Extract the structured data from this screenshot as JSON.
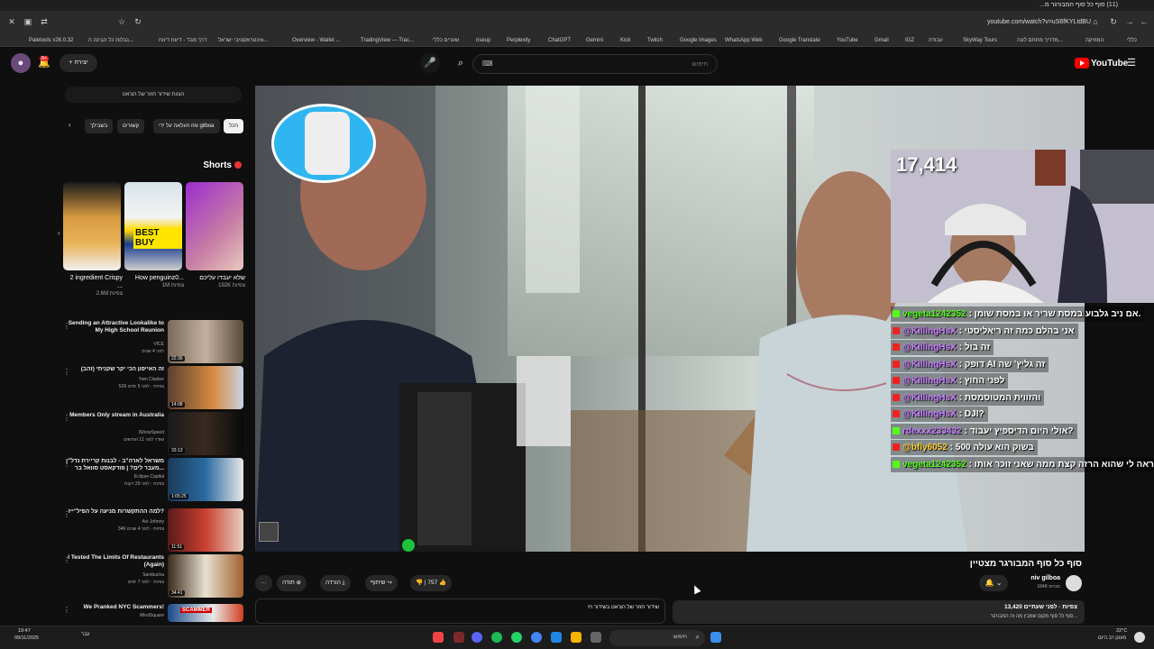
{
  "browser": {
    "tab_title": "(11) סוף כל סוף המבורגר מ...",
    "url": "youtube.com/watch?v=uS6fKYLtdBU",
    "bookmarks": [
      "Paletools v26.0.32",
      "נבלות כל הבינה ה...",
      "דרך מבד - דיווח דיווח",
      "אינטראקטיבי ישראל...",
      "Overview - Wallet ...",
      "TradingView — Trac...",
      "שערים כללי",
      "riseup",
      "Perplexity",
      "ChatGPT",
      "Gemini",
      "Kick",
      "Twitch",
      "Google Images",
      "WhatsApp Web",
      "Google Translate",
      "YouTube",
      "Gmail",
      "IGZ",
      "עבודה",
      "SkyWay Tours",
      "מדריך מתחם לונה...",
      "המוזיקה",
      "כללי"
    ]
  },
  "header": {
    "create_label": "+ יצירה",
    "search_placeholder": "חיפוש",
    "logo_text": "YouTube",
    "notification_count": "9+"
  },
  "sidebar": {
    "top_button": "הצגת שידור חוזר של הצ'אט",
    "chips": [
      "הכל",
      "העלאה על ידי niv gilboa",
      "קשורים",
      "בשבילך"
    ],
    "shorts_heading": "Shorts",
    "shorts": [
      {
        "title": "שלא יעבדו עליכם",
        "views": "192K צפיות"
      },
      {
        "title": "How penguinz0...",
        "views": "1M צפיות"
      },
      {
        "title": "2 ingredient Crispy ...",
        "views": "2.6M צפיות"
      }
    ],
    "recommendations": [
      {
        "title": "Sending an Attractive Lookalike to My High School Reunion",
        "channel": "VICE",
        "meta": "לפני 4 שנים",
        "duration": "22:36"
      },
      {
        "title": "זה האייפון הכי יקר שקניתי (זהב)",
        "channel": "Yam Clasker",
        "meta": "52K צפיות · לפני 5 ימים",
        "duration": "14:08"
      },
      {
        "title": "Members Only stream in Australia",
        "channel": "IShowSpeed",
        "meta": "שודר לפני 11 חודשים",
        "duration": "33:13"
      },
      {
        "title": "משראל לארה\"ב - לבנות קריירת נדל\"ן מעבר לים? | פודקאסט סוואל בר...",
        "channel": "Eclipse Capital",
        "meta": "צפיות · לפני 29 דקות",
        "duration": "1:05:25"
      },
      {
        "title": "למה ההתקשרות מניעה על הפיל\"ייז?",
        "channel": "Avi Johnny",
        "meta": "34K צפיות · לפני 4 שנים",
        "duration": "11:51"
      },
      {
        "title": "I Tested The Limits Of Restaurants (Again)",
        "channel": "Sambucha",
        "meta": "צפיות · לפני 7 ימים",
        "duration": "34:41"
      },
      {
        "title": "We Pranked NYC Scammers!",
        "channel": "MindSquare",
        "meta": "",
        "duration": ""
      }
    ]
  },
  "stream_overlay": {
    "viewer_count": "17,414",
    "chat": [
      {
        "user": "vegeta1242352",
        "text": "אם ניב גלבוע במסת שריר או במסת שומן.",
        "badge": "#53fc18"
      },
      {
        "user": "@KillingHsX",
        "text": "אני בהלם כמה זה ריאליסטי",
        "badge": "#e22"
      },
      {
        "user": "@KillingHsX",
        "text": "זה בול",
        "badge": "#e22"
      },
      {
        "user": "@KillingHsX",
        "text": "דופק AI זה גליץ' שה",
        "badge": "#e22"
      },
      {
        "user": "@KillingHsX",
        "text": "לפני החוץ",
        "badge": "#e22"
      },
      {
        "user": "@KillingHsX",
        "text": "והזווית המטוסמסת",
        "badge": "#e22"
      },
      {
        "user": "@KillingHsX",
        "text": "DJI?",
        "badge": "#e22"
      },
      {
        "user": "rdexxx233432",
        "text": "אולי היום הדיספיץ יעבוד?",
        "badge": "#53fc18"
      },
      {
        "user": "@bfly6052",
        "text": "בשוק הוא עולה 500",
        "badge": "#e22"
      },
      {
        "user": "vegeta1242352",
        "text": "מן נראה לי שהוא הרזה קצת ממה שאני זוכר אותו",
        "badge": "#53fc18"
      }
    ]
  },
  "video": {
    "title": "סוף כל סוף המבורגר מצטיין",
    "channel": "niv gilboa",
    "subscribers": "184K מנויים",
    "likes": "757",
    "share_label": "שיתוף",
    "download_label": "הורדה",
    "thanks_label": "תודה",
    "more_label": "···",
    "views_line": "13,420 צפיות · לפני שעתיים",
    "desc_line": "סוף כל סוף מקום שמבין מה זה המבורגר...",
    "chat_replay_label": "שידור חוזר של הצ'אט בשידור חי"
  },
  "taskbar": {
    "time": "19:47",
    "date": "09/11/2025",
    "lang": "עבר",
    "search_placeholder": "חיפוש",
    "weather_temp": "22°C",
    "weather_text": "מעונן רב היום"
  }
}
